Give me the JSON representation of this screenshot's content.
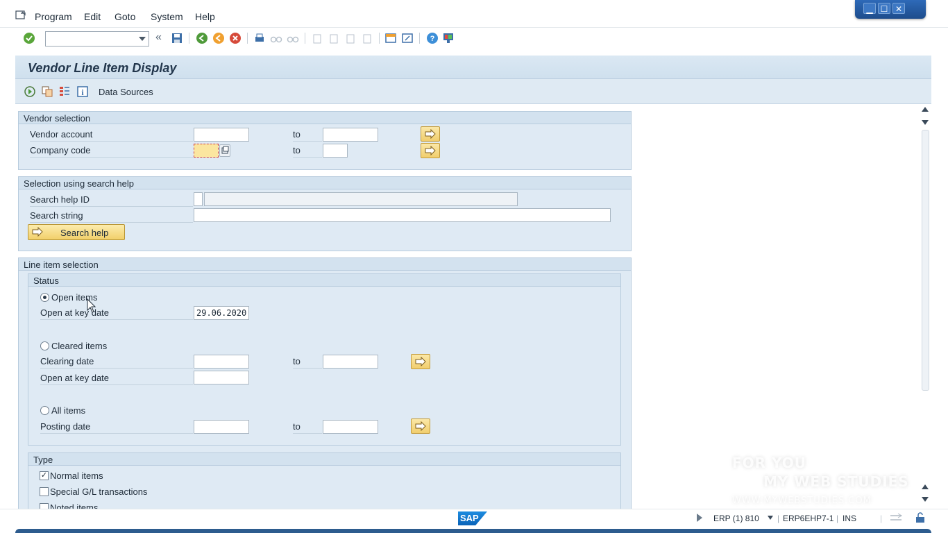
{
  "menu": {
    "items": [
      {
        "label": "Program"
      },
      {
        "label": "Edit"
      },
      {
        "label": "Goto"
      },
      {
        "label": "System"
      },
      {
        "label": "Help"
      }
    ]
  },
  "window_controls": {
    "minimize": "▁",
    "maximize": "☐",
    "close": "✕"
  },
  "screen": {
    "title": "Vendor Line Item Display",
    "app_toolbar": {
      "data_sources_label": "Data Sources"
    }
  },
  "vendor_selection": {
    "header": "Vendor selection",
    "vendor_account_label": "Vendor account",
    "company_code_label": "Company code",
    "to_label": "to",
    "vendor_account_from": "",
    "vendor_account_to": "",
    "company_code_from": "",
    "company_code_to": ""
  },
  "search_help": {
    "header": "Selection using search help",
    "search_help_id_label": "Search help ID",
    "search_string_label": "Search string",
    "button_label": "Search help"
  },
  "line_item_selection": {
    "header": "Line item selection",
    "status": {
      "header": "Status",
      "open_items_label": "Open items",
      "open_at_key_date_label": "Open at key date",
      "open_at_key_date_value": "29.06.2020",
      "cleared_items_label": "Cleared items",
      "clearing_date_label": "Clearing date",
      "cleared_open_at_key_date_label": "Open at key date",
      "all_items_label": "All items",
      "posting_date_label": "Posting date",
      "to_label": "to",
      "selected": "Open items"
    },
    "type": {
      "header": "Type",
      "normal_items_label": "Normal items",
      "normal_items_checked": true,
      "special_gl_label": "Special G/L transactions",
      "special_gl_checked": false,
      "noted_items_label": "Noted items",
      "noted_items_checked": false
    }
  },
  "status_bar": {
    "system": "ERP (1) 810",
    "server": "ERP6EHP7-1",
    "mode": "INS",
    "logo": "SAP"
  },
  "watermark": {
    "line1": "FOR YOU",
    "line2": "MY WEB STUDIES",
    "line3": "WWW.MYWEBSTUDIES.COM"
  },
  "colors": {
    "accent": "#1d4c8c",
    "group_background": "#dfeaf4",
    "button_yellow": "#f2d06a"
  }
}
